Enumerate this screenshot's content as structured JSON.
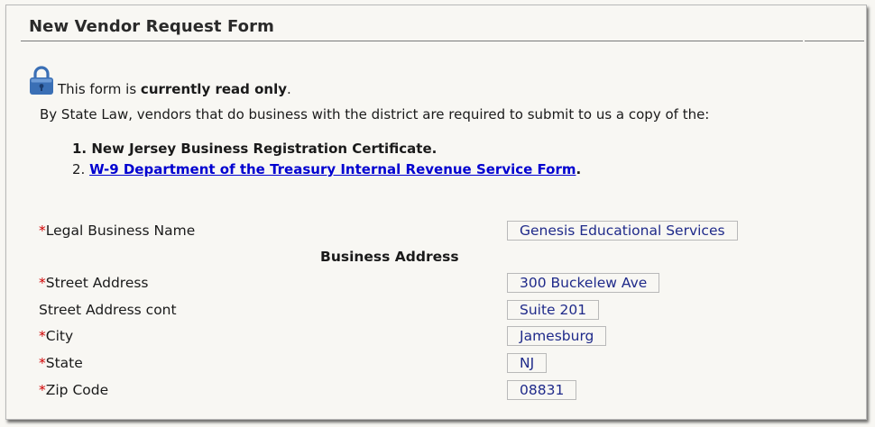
{
  "form": {
    "title": "New Vendor Request Form",
    "readonly_prefix": "This form is ",
    "readonly_strong": "currently read only",
    "readonly_suffix": ".",
    "law_text": "By State Law, vendors that do business with the district are required to submit to us a copy of the:",
    "requirement_1": "1. New Jersey Business Registration Certificate.",
    "requirement_2_prefix": "2. ",
    "requirement_2_link": "W-9 Department of the Treasury Internal Revenue Service Form",
    "requirement_2_suffix": ".",
    "lock_icon": "lock-icon"
  },
  "fields": {
    "required_marker": "*",
    "legal_name_label": "Legal Business Name",
    "legal_name_value": "Genesis Educational Services",
    "section_heading": "Business Address",
    "street_label": "Street Address",
    "street_value": "300 Buckelew Ave",
    "street2_label": "Street Address cont",
    "street2_value": "Suite 201",
    "city_label": "City",
    "city_value": "Jamesburg",
    "state_label": "State",
    "state_value": "NJ",
    "zip_label": "Zip Code",
    "zip_value": "08831"
  },
  "colors": {
    "background": "#f8f7f3",
    "required": "#d00000",
    "link": "#0000d0",
    "value_text": "#1f2a8a",
    "lock": "#3a6fb5"
  }
}
